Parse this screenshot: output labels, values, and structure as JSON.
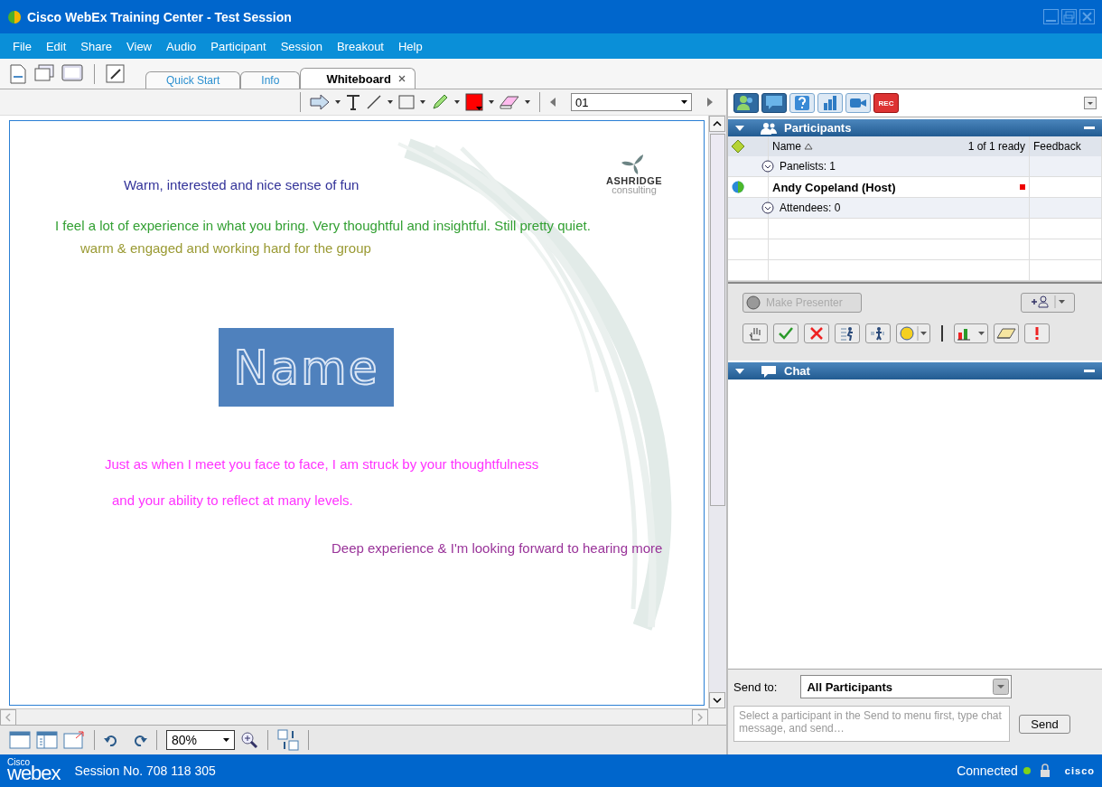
{
  "window": {
    "title": "Cisco WebEx Training Center - Test Session"
  },
  "menu": [
    "File",
    "Edit",
    "Share",
    "View",
    "Audio",
    "Participant",
    "Session",
    "Breakout",
    "Help"
  ],
  "tabs": [
    {
      "label": "Quick Start",
      "selected": false,
      "closable": false
    },
    {
      "label": "Info",
      "selected": false,
      "closable": false
    },
    {
      "label": "Whiteboard",
      "selected": true,
      "closable": true
    }
  ],
  "whiteboard": {
    "page": "01",
    "texts": [
      {
        "text": "Warm, interested and nice sense of fun",
        "color": "#333399"
      },
      {
        "text": "I feel a lot of experience in what you bring. Very thoughtful and insightful. Still pretty quiet.",
        "color": "#33a033"
      },
      {
        "text": "warm & engaged and working hard for the group",
        "color": "#9a9a33"
      },
      {
        "text": "Just as when I meet you face to face, I am struck by your thoughtfulness",
        "color": "#ff33ff"
      },
      {
        "text": "and your ability to reflect at many levels.",
        "color": "#ff33ff"
      },
      {
        "text": "Deep experience & I'm looking forward to hearing more",
        "color": "#993399"
      }
    ],
    "name_box": "Name",
    "logo": {
      "name": "ASHRIDGE",
      "tagline": "consulting"
    }
  },
  "panel_tabs": [
    {
      "kind": "participants",
      "selected": true
    },
    {
      "kind": "chat",
      "selected": true
    },
    {
      "kind": "quiz",
      "selected": false
    },
    {
      "kind": "poll",
      "selected": false
    },
    {
      "kind": "video",
      "selected": false
    },
    {
      "kind": "record",
      "selected": false,
      "label": "REC"
    }
  ],
  "participants": {
    "title": "Participants",
    "columns": [
      "Name",
      "1 of 1 ready",
      "Feedback"
    ],
    "rows": [
      {
        "kind": "group",
        "label": "Panelists: 1"
      },
      {
        "kind": "person",
        "label": "Andy Copeland (Host)"
      },
      {
        "kind": "group",
        "label": "Attendees: 0"
      }
    ],
    "make_presenter": {
      "label": "Make Presenter",
      "disabled": true
    }
  },
  "chat": {
    "title": "Chat",
    "send_to_label": "Send to:",
    "send_to": "All Participants",
    "placeholder": "Select a participant in the Send to menu first, type chat message, and send…",
    "send": "Send"
  },
  "zoom": "80%",
  "status_bar": {
    "brand_small": "Cisco",
    "brand": "webex",
    "session": "Session No. 708 118 305",
    "connection": "Connected",
    "cisco_logo": "cisco"
  }
}
